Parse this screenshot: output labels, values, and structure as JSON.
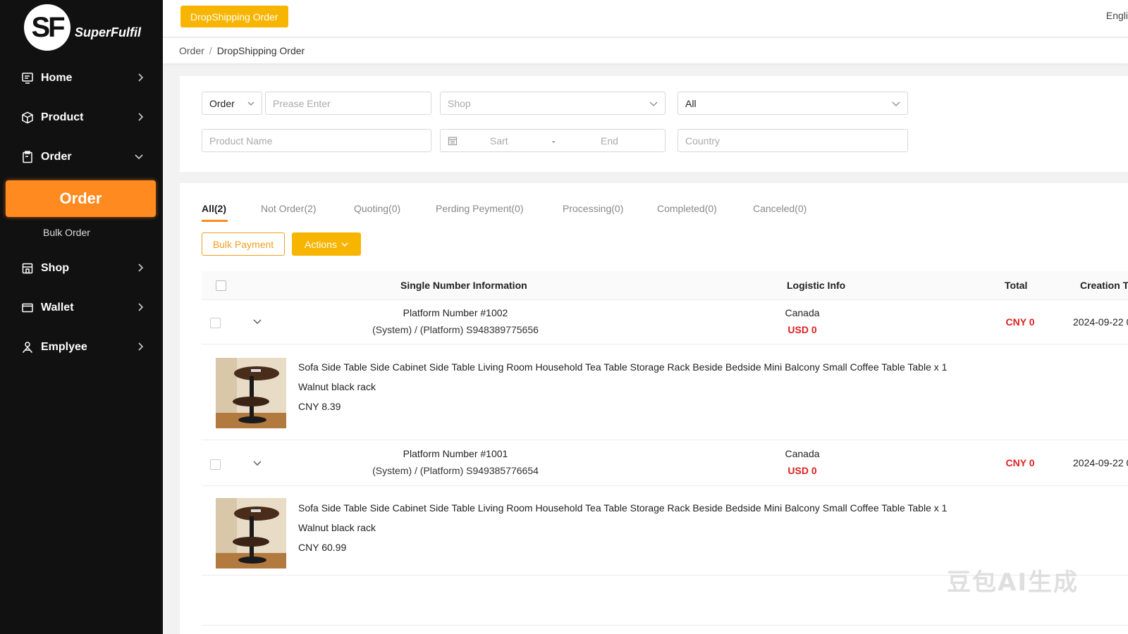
{
  "sidebar": {
    "logo_initials": "SF",
    "logo_text": "SuperFulfil",
    "items": [
      {
        "label": "Home"
      },
      {
        "label": "Product"
      },
      {
        "label": "Order"
      },
      {
        "label": "Shop"
      },
      {
        "label": "Wallet"
      },
      {
        "label": "Emplyee"
      }
    ],
    "active_sub": "Order",
    "sub_item": "Bulk Order"
  },
  "header": {
    "tab": "DropShipping Order",
    "language": "Engli"
  },
  "breadcrumb": {
    "root": "Order",
    "separator": "/",
    "current": "DropShipping Order"
  },
  "filters": {
    "order_type": "Order",
    "order_input_placeholder": "Prease Enter",
    "shop_placeholder": "Shop",
    "status_value": "All",
    "product_placeholder": "Product Name",
    "date_start": "Sart",
    "date_separator": "-",
    "date_end": "End",
    "country_placeholder": "Country"
  },
  "tabs": [
    {
      "label": "All(2)"
    },
    {
      "label": "Not Order(2)"
    },
    {
      "label": "Quoting(0)"
    },
    {
      "label": "Perding Peyment(0)"
    },
    {
      "label": "Processing(0)"
    },
    {
      "label": "Completed(0)"
    },
    {
      "label": "Canceled(0)"
    }
  ],
  "actions": {
    "bulk_payment": "Bulk Payment",
    "actions": "Actions"
  },
  "table": {
    "headers": {
      "single": "Single Number Information",
      "logistic": "Logistic Info",
      "total": "Total",
      "creation": "Creation T"
    },
    "orders": [
      {
        "platform": "Platform Number #1002",
        "system": "(System) / (Platform) S948389775656",
        "country": "Canada",
        "logistic_price": "USD 0",
        "total": "CNY 0",
        "created": "2024-09-22 0",
        "product_title": "Sofa Side Table Side Cabinet Side Table Living Room Household Tea Table Storage Rack Beside Bedside Mini Balcony Small Coffee Table Table x 1",
        "variant": "Walnut black rack",
        "price": "CNY 8.39"
      },
      {
        "platform": "Platform Number #1001",
        "system": "(System) / (Platform) S949385776654",
        "country": "Canada",
        "logistic_price": "USD 0",
        "total": "CNY 0",
        "created": "2024-09-22 0",
        "product_title": "Sofa Side Table Side Cabinet Side Table Living Room Household Tea Table Storage Rack Beside Bedside Mini Balcony Small Coffee Table Table x 1",
        "variant": "Walnut black rack",
        "price": "CNY 60.99"
      }
    ]
  },
  "watermark": "豆包AI生成",
  "colors": {
    "accent_orange": "#ff8a1f",
    "accent_yellow": "#f7b500",
    "price_red": "#e02020",
    "sidebar_bg": "#111111"
  }
}
